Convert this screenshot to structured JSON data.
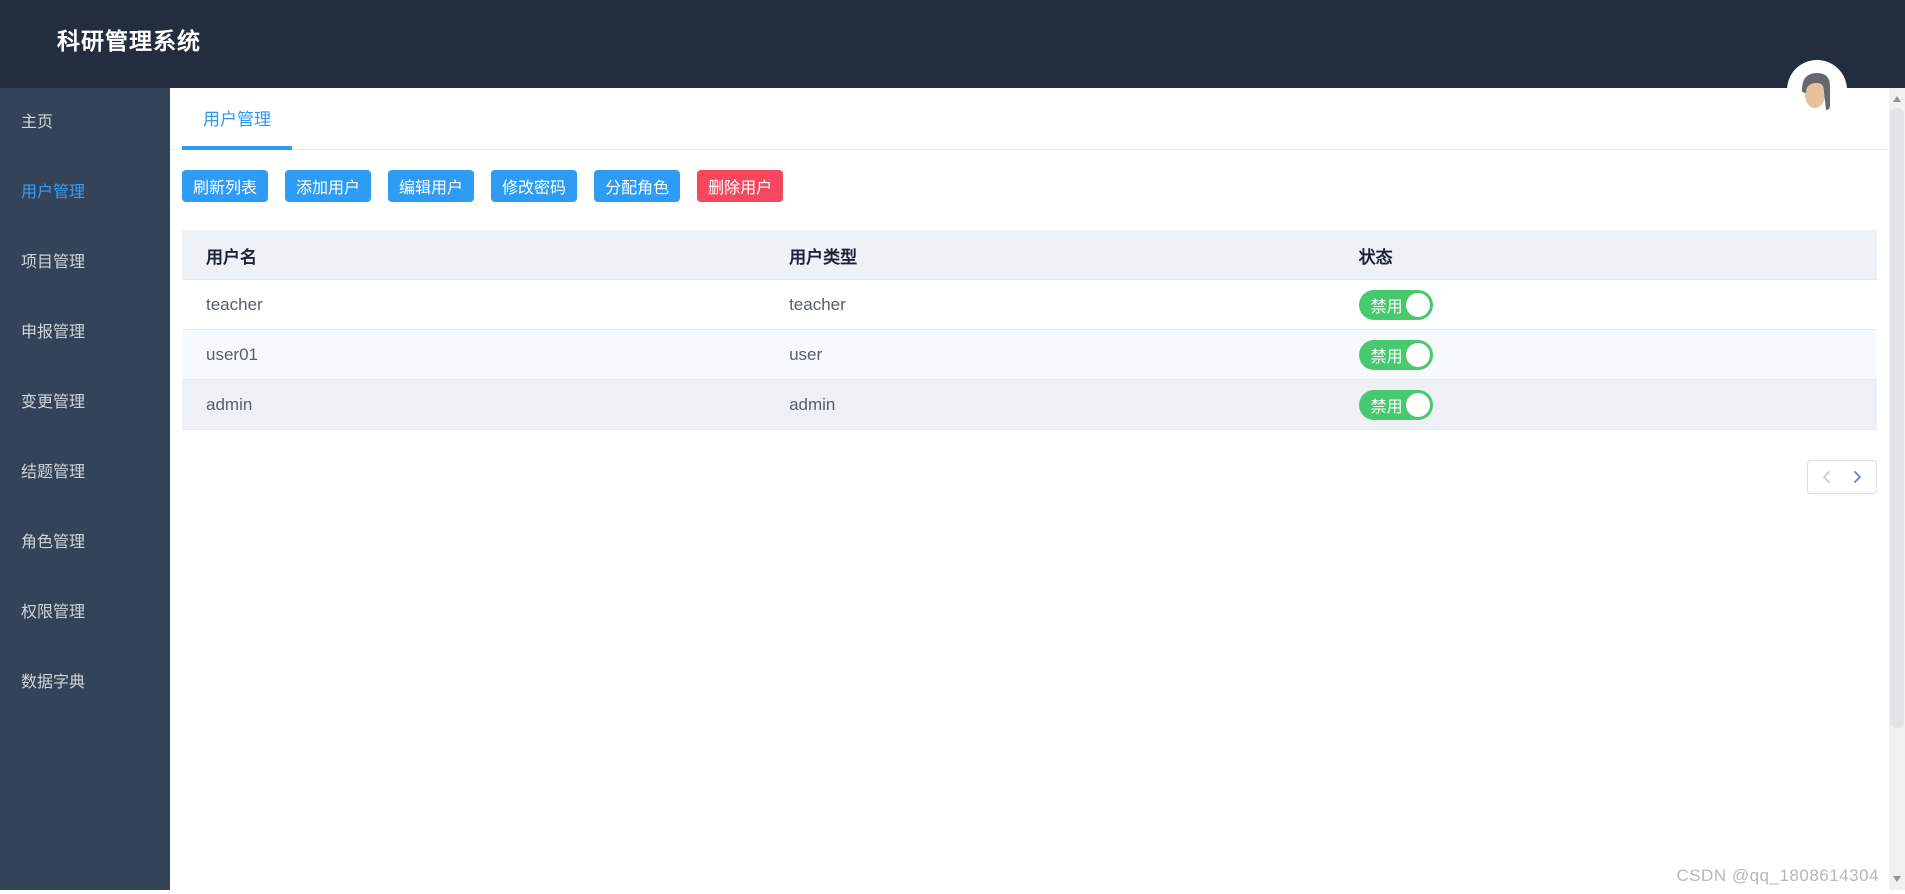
{
  "app": {
    "title": "科研管理系统"
  },
  "sidebar": {
    "items": [
      {
        "label": "主页",
        "active": false
      },
      {
        "label": "用户管理",
        "active": true
      },
      {
        "label": "项目管理",
        "active": false
      },
      {
        "label": "申报管理",
        "active": false
      },
      {
        "label": "变更管理",
        "active": false
      },
      {
        "label": "结题管理",
        "active": false
      },
      {
        "label": "角色管理",
        "active": false
      },
      {
        "label": "权限管理",
        "active": false
      },
      {
        "label": "数据字典",
        "active": false
      }
    ]
  },
  "tabs": {
    "items": [
      {
        "label": "用户管理",
        "active": true
      }
    ]
  },
  "toolbar": {
    "buttons": [
      {
        "label": "刷新列表",
        "type": "primary"
      },
      {
        "label": "添加用户",
        "type": "primary"
      },
      {
        "label": "编辑用户",
        "type": "primary"
      },
      {
        "label": "修改密码",
        "type": "primary"
      },
      {
        "label": "分配角色",
        "type": "primary"
      },
      {
        "label": "删除用户",
        "type": "danger"
      }
    ]
  },
  "table": {
    "columns": [
      "用户名",
      "用户类型",
      "状态"
    ],
    "rows": [
      {
        "username": "teacher",
        "user_type": "teacher",
        "status": {
          "label": "禁用",
          "on": true
        }
      },
      {
        "username": "user01",
        "user_type": "user",
        "status": {
          "label": "禁用",
          "on": true
        }
      },
      {
        "username": "admin",
        "user_type": "admin",
        "status": {
          "label": "禁用",
          "on": true
        }
      }
    ]
  },
  "pagination": {
    "prev_enabled": false,
    "next_enabled": true
  },
  "watermark": "CSDN @qq_1808614304",
  "colors": {
    "header_bg": "#222d3e",
    "sidebar_bg": "#344358",
    "accent_blue": "#2e9cf4",
    "danger_red": "#f5485e",
    "toggle_green": "#47c96e",
    "table_header_bg": "#eef1f6"
  }
}
